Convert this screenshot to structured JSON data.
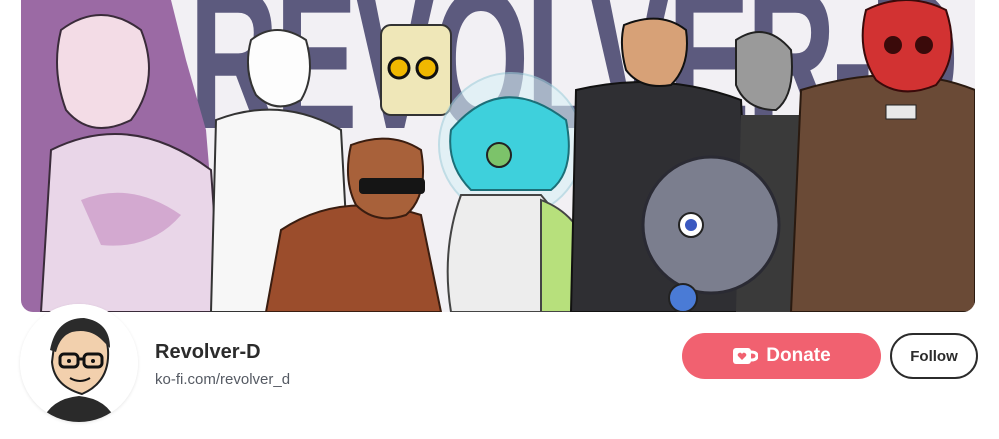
{
  "banner": {
    "wordmark": "REVOLVER-D"
  },
  "profile": {
    "name": "Revolver-D",
    "url": "ko-fi.com/revolver_d"
  },
  "actions": {
    "donate_label": "Donate",
    "follow_label": "Follow"
  },
  "colors": {
    "donate": "#f16170",
    "follow_border": "#2b2b2b",
    "wordmark": "#5c5a7e"
  },
  "icons": {
    "donate": "ko-fi-cup-icon"
  }
}
